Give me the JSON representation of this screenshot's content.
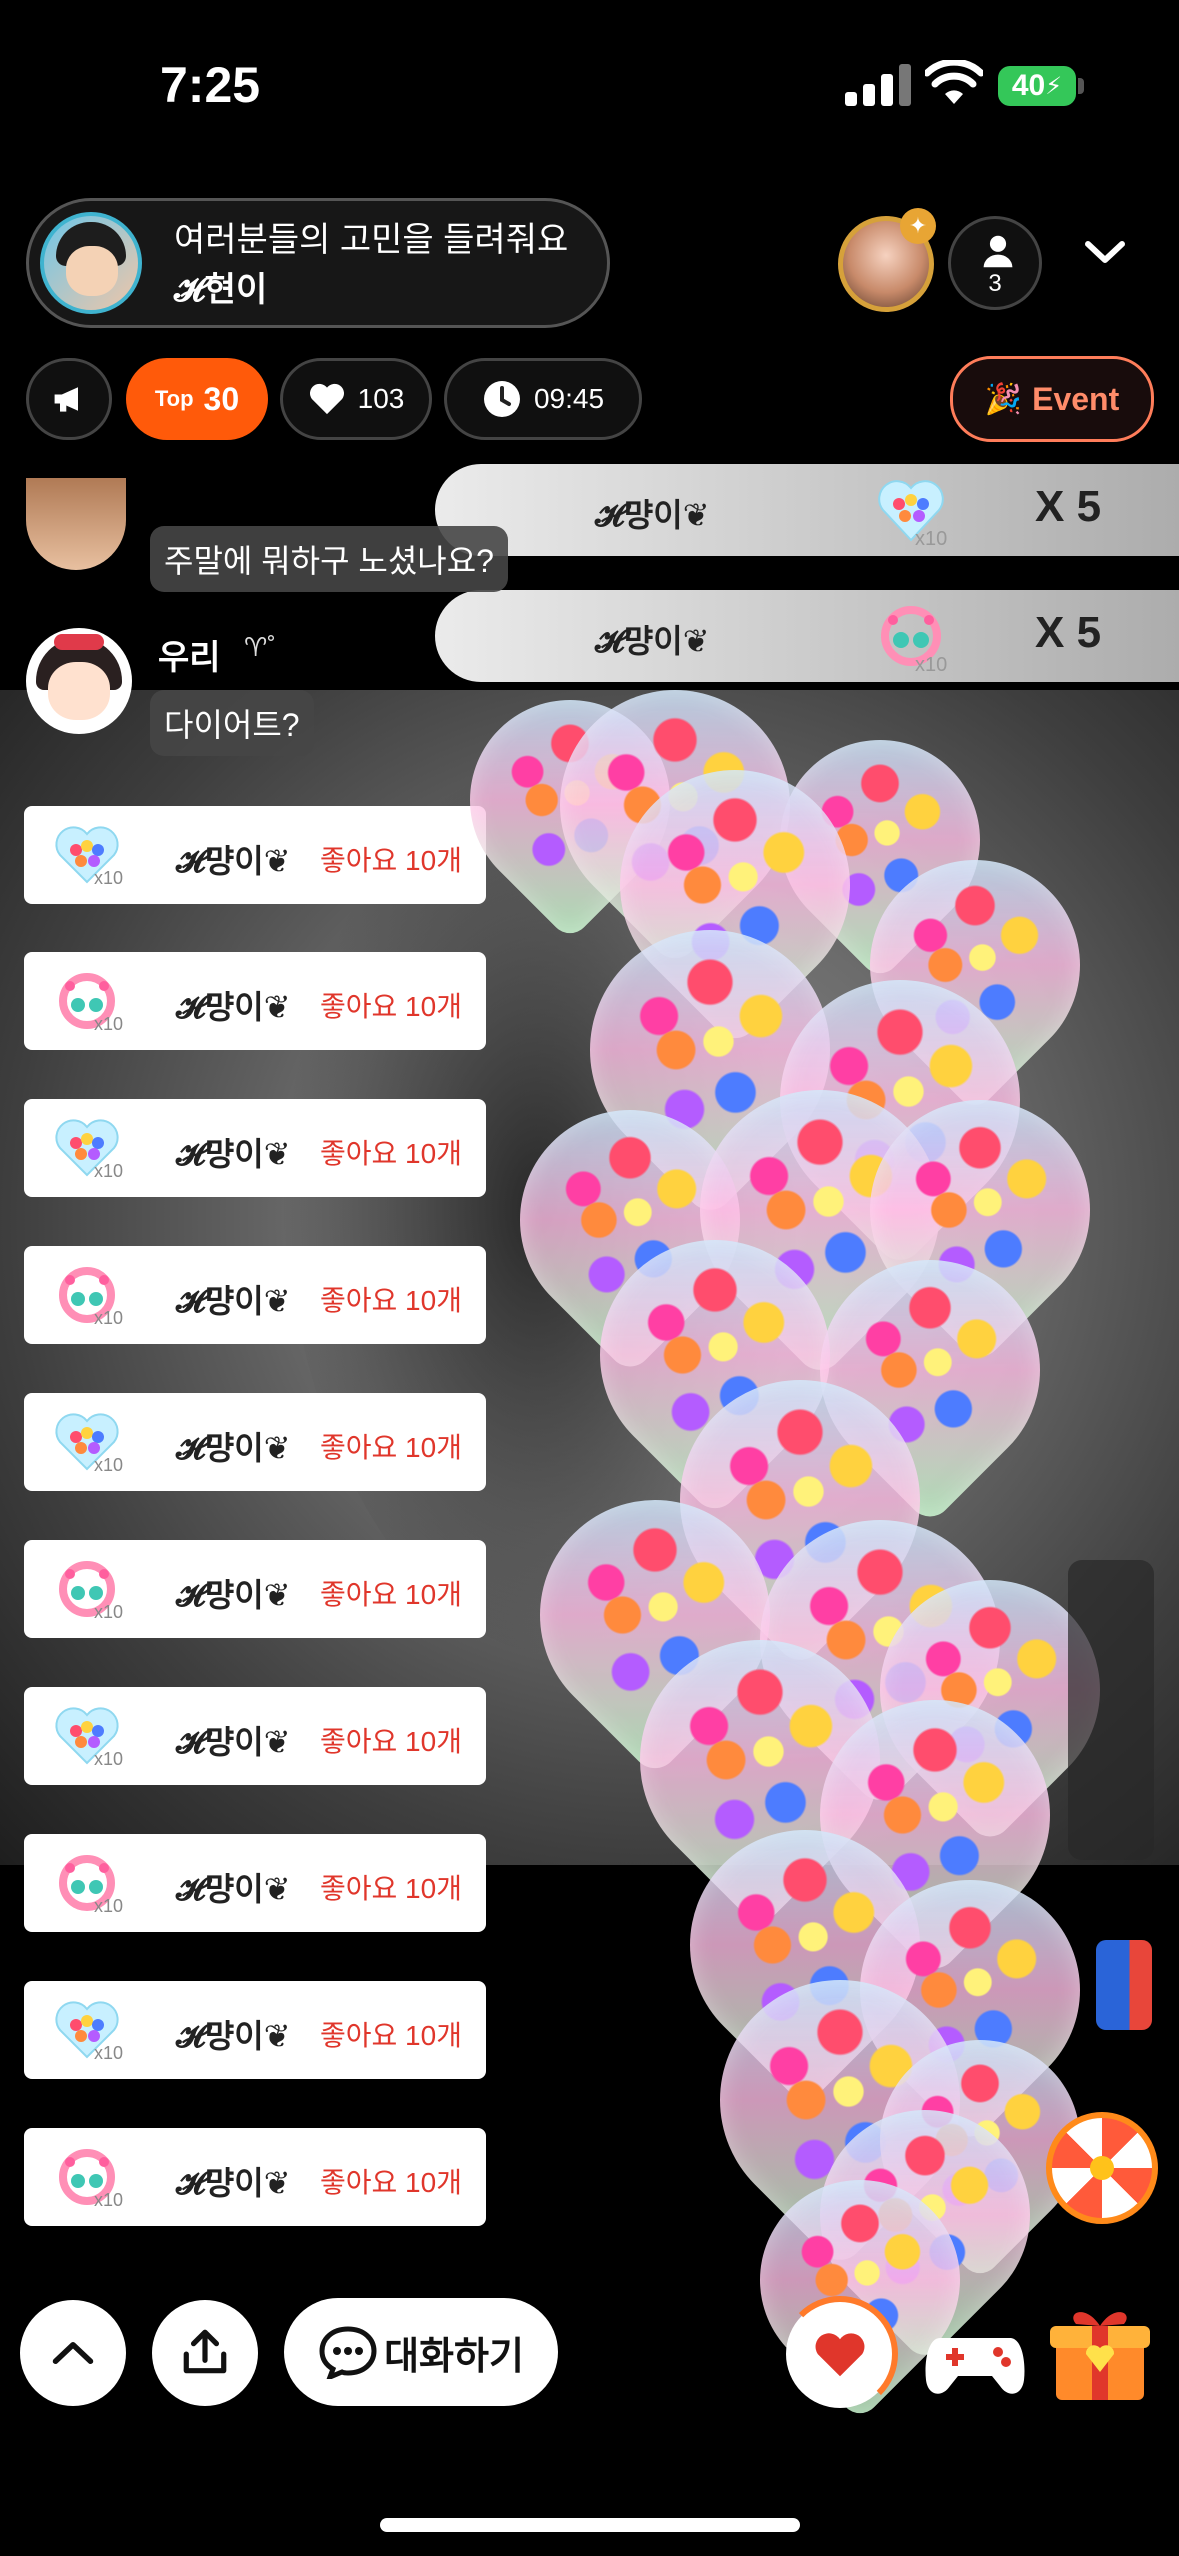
{
  "status": {
    "time": "7:25",
    "battery": "40"
  },
  "host": {
    "title": "여러분들의 고민을 들려줘요",
    "name": "𝓗현이"
  },
  "viewers": {
    "count": "3"
  },
  "stats": {
    "top_small": "Top",
    "top_rank": "30",
    "likes": "103",
    "elapsed": "09:45",
    "event_label": "Event"
  },
  "gift_banners": [
    {
      "sender": "𝓗먕이❦",
      "multiplier": "X 5",
      "badge": "x10"
    },
    {
      "sender": "𝓗먕이❦",
      "multiplier": "X 5",
      "badge": "x10"
    }
  ],
  "chat": {
    "msg1": "주말에 뭐하구 노셨나요?",
    "woori_name": "우리",
    "woori_sym": "♈︎˚",
    "woori_msg": "다이어트?"
  },
  "likes_feed": [
    {
      "who": "𝓗먕이❦",
      "what": "좋아요 10개",
      "badge": "x10",
      "icon": "heart-bouquet-icon"
    },
    {
      "who": "𝓗먕이❦",
      "what": "좋아요 10개",
      "badge": "x10",
      "icon": "bird-wreath-icon"
    },
    {
      "who": "𝓗먕이❦",
      "what": "좋아요 10개",
      "badge": "x10",
      "icon": "heart-bouquet-icon"
    },
    {
      "who": "𝓗먕이❦",
      "what": "좋아요 10개",
      "badge": "x10",
      "icon": "bird-wreath-icon"
    },
    {
      "who": "𝓗먕이❦",
      "what": "좋아요 10개",
      "badge": "x10",
      "icon": "heart-bouquet-icon"
    },
    {
      "who": "𝓗먕이❦",
      "what": "좋아요 10개",
      "badge": "x10",
      "icon": "bird-wreath-icon"
    },
    {
      "who": "𝓗먕이❦",
      "what": "좋아요 10개",
      "badge": "x10",
      "icon": "heart-bouquet-icon"
    },
    {
      "who": "𝓗먕이❦",
      "what": "좋아요 10개",
      "badge": "x10",
      "icon": "bird-wreath-icon"
    },
    {
      "who": "𝓗먕이❦",
      "what": "좋아요 10개",
      "badge": "x10",
      "icon": "heart-bouquet-icon"
    },
    {
      "who": "𝓗먕이❦",
      "what": "좋아요 10개",
      "badge": "x10",
      "icon": "bird-wreath-icon"
    }
  ],
  "bottom": {
    "chat_label": "대화하기"
  },
  "colors": {
    "accent": "#ff5a0a",
    "like_red": "#e0362b",
    "battery_green": "#34c759"
  }
}
